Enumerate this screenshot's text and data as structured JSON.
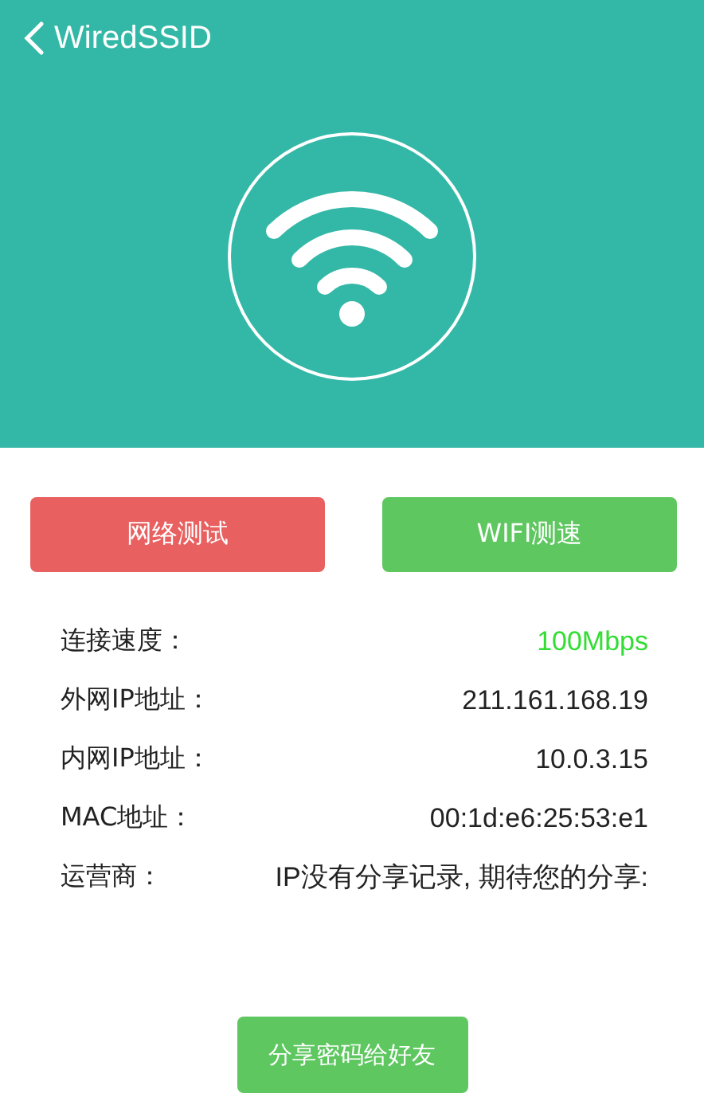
{
  "header": {
    "title": "WiredSSID"
  },
  "buttons": [
    {
      "label": "网络测试",
      "kind": "danger"
    },
    {
      "label": "WIFI测速",
      "kind": "success"
    }
  ],
  "info": [
    {
      "label": "连接速度：",
      "value": "100Mbps",
      "highlighted": true
    },
    {
      "label": "外网IP地址：",
      "value": "211.161.168.19",
      "highlighted": false
    },
    {
      "label": "内网IP地址：",
      "value": "10.0.3.15",
      "highlighted": false
    },
    {
      "label": "MAC地址：",
      "value": "00:1d:e6:25:53:e1",
      "highlighted": false
    },
    {
      "label": "运营商：",
      "value": "IP没有分享记录, 期待您的分享:",
      "highlighted": false
    }
  ],
  "share_button": {
    "label": "分享密码给好友"
  }
}
